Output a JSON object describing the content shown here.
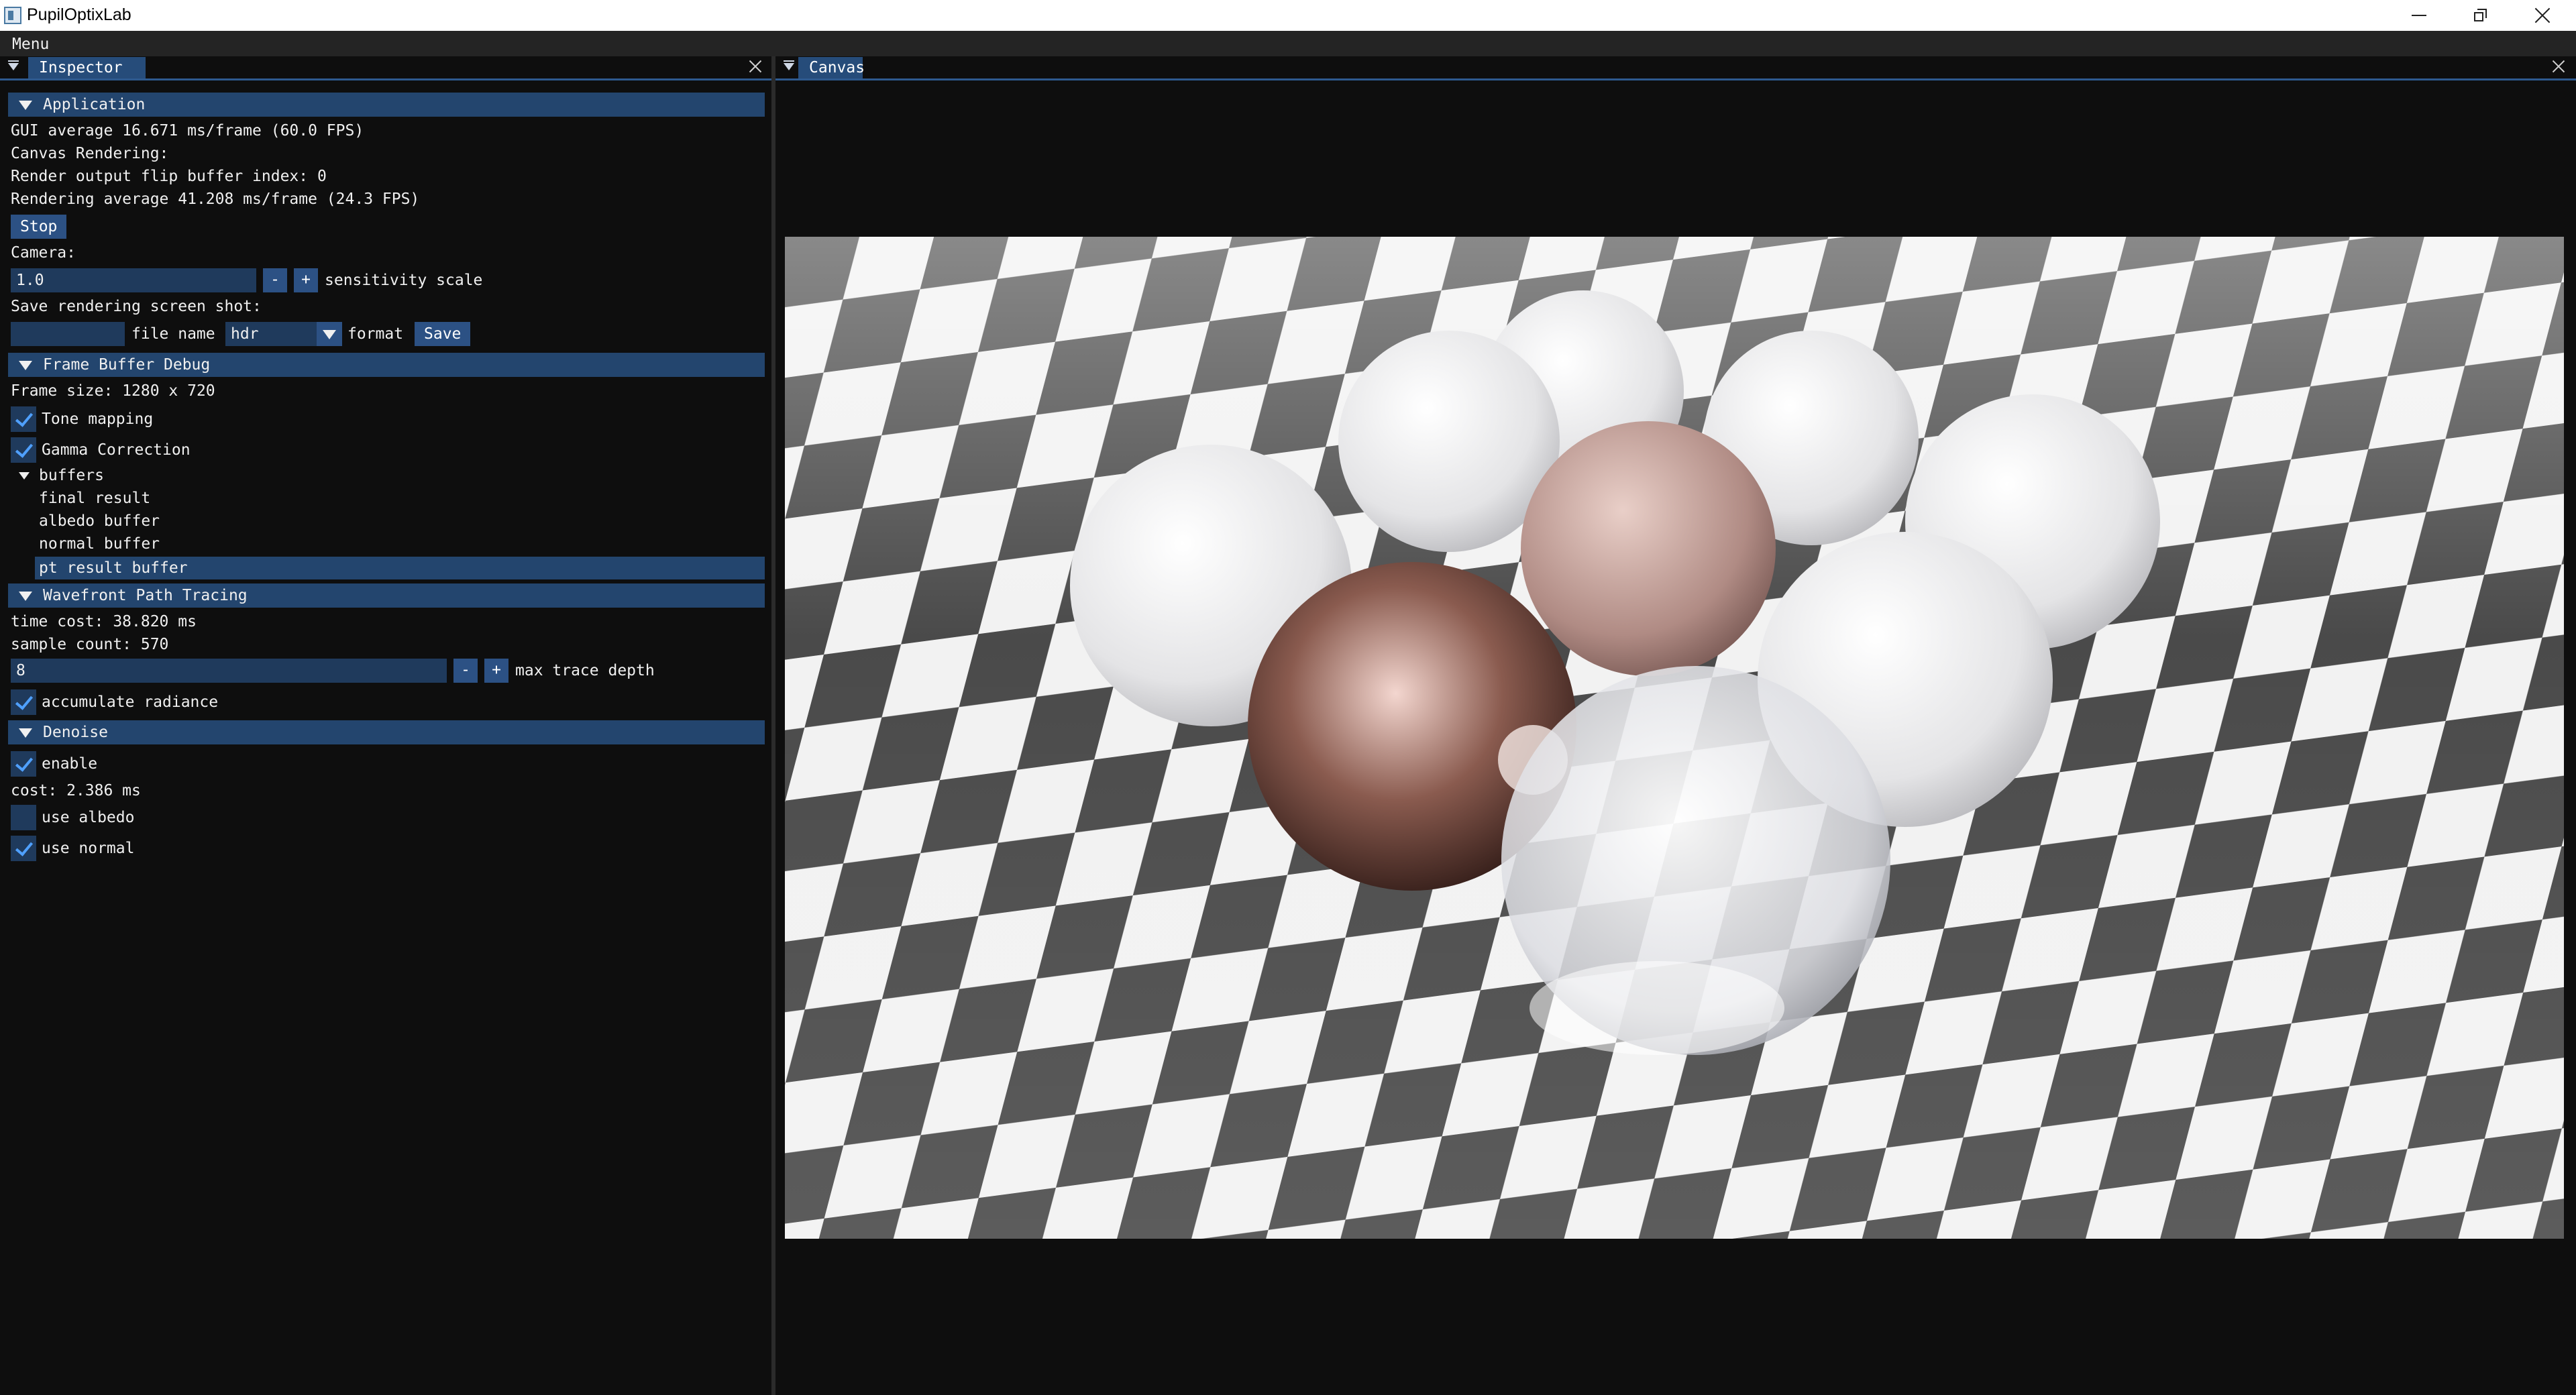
{
  "window": {
    "title": "PupilOptixLab"
  },
  "menubar": {
    "menu_label": "Menu"
  },
  "inspector": {
    "tab_label": "Inspector",
    "application": {
      "header": "Application",
      "gui_average": "GUI average 16.671 ms/frame (60.0 FPS)",
      "canvas_rendering": "Canvas Rendering:",
      "flip_buffer": "Render output flip buffer index: 0",
      "rendering_average": "Rendering average 41.208 ms/frame (24.3 FPS)",
      "stop_label": "Stop",
      "camera_label": "Camera:",
      "sensitivity_value": "1.0",
      "minus_label": "-",
      "plus_label": "+",
      "sensitivity_label": "sensitivity scale",
      "screenshot_label": "Save rendering screen shot:",
      "file_name_value": "",
      "file_name_label": "file name",
      "format_value": "hdr",
      "format_label": "format",
      "save_label": "Save"
    },
    "frame_buffer": {
      "header": "Frame Buffer Debug",
      "frame_size": "Frame size: 1280 x 720",
      "tone_mapping_label": "Tone mapping",
      "tone_mapping_checked": true,
      "gamma_label": "Gamma Correction",
      "gamma_checked": true,
      "buffers_label": "buffers",
      "buffers": [
        "final result",
        "albedo buffer",
        "normal buffer",
        "pt result buffer"
      ],
      "selected_buffer": "pt result buffer"
    },
    "path_tracing": {
      "header": "Wavefront Path Tracing",
      "time_cost": "time cost: 38.820 ms",
      "sample_count": "sample count: 570",
      "max_depth_value": "8",
      "minus_label": "-",
      "plus_label": "+",
      "max_depth_label": "max trace depth",
      "accumulate_label": "accumulate radiance",
      "accumulate_checked": true
    },
    "denoise": {
      "header": "Denoise",
      "enable_label": "enable",
      "enable_checked": true,
      "cost": "cost: 2.386 ms",
      "use_albedo_label": "use albedo",
      "use_albedo_checked": false,
      "use_normal_label": "use normal",
      "use_normal_checked": true
    }
  },
  "canvas": {
    "tab_label": "Canvas"
  },
  "colors": {
    "panel_bg": "#0e0e0e",
    "header_bg": "#23456e",
    "button_bg": "#2c5184",
    "input_bg": "#1f3a5c",
    "check_mark": "#4fa0ff"
  }
}
